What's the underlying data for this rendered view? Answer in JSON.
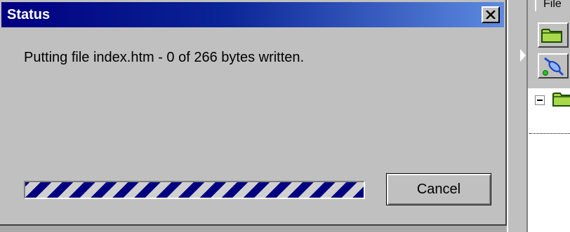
{
  "dialog": {
    "title": "Status",
    "message": "Putting file index.htm - 0 of 266 bytes written.",
    "cancel_label": "Cancel",
    "progress": {
      "style": "indeterminate-marquee",
      "color": "#000080"
    }
  },
  "colors": {
    "titlebar_start": "#000080",
    "titlebar_end": "#5d8be0",
    "face": "#c0c0c0"
  },
  "background_app": {
    "panel_tab_label": "File",
    "icons": [
      "folder-icon",
      "connect-icon",
      "folder-icon"
    ]
  }
}
